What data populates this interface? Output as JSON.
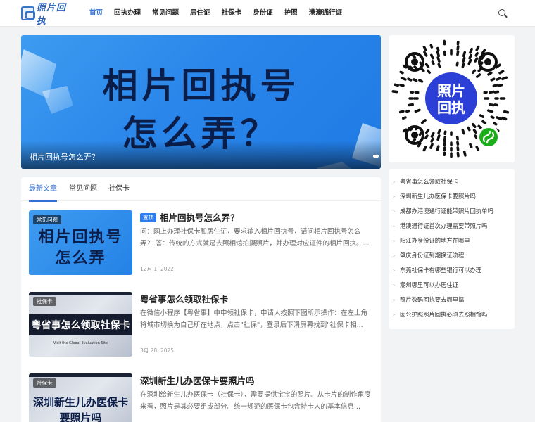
{
  "header": {
    "logo_text": "照片回执",
    "nav": [
      {
        "label": "首页",
        "active": true
      },
      {
        "label": "回执办理",
        "active": false
      },
      {
        "label": "常见问题",
        "active": false
      },
      {
        "label": "居住证",
        "active": false
      },
      {
        "label": "社保卡",
        "active": false
      },
      {
        "label": "身份证",
        "active": false
      },
      {
        "label": "护照",
        "active": false
      },
      {
        "label": "港澳通行证",
        "active": false
      }
    ],
    "search_icon": "search-icon"
  },
  "banner": {
    "line1": "相片回执号",
    "line2": "怎么弄？",
    "caption": "相片回执号怎么弄？"
  },
  "tabs": [
    "最新文章",
    "常见问题",
    "社保卡"
  ],
  "posts": [
    {
      "thumb_tag": "常见问题",
      "thumb_line1": "相片回执号",
      "thumb_line2": "怎么弄",
      "badge": "置顶",
      "title": "相片回执号怎么弄？",
      "excerpt": "问：网上办理社保卡和居住证，要求输入相片回执号，请问相片回执号怎么弄？ 答：传统的方式就是去照相馆拍摄照片，并办理对应证件的相片回执。...",
      "date": "12月 1, 2022"
    },
    {
      "thumb_tag": "社保卡",
      "thumb_line1": "粤省事怎么领取社保卡",
      "thumb_small": "Visit the Global Evaluation Site",
      "title": "粤省事怎么领取社保卡",
      "excerpt": "在微信小程序【粤省事】中申领社保卡，申请人按照下图所示操作：在左上角将城市切换为自己所在地点，点击\"社保\"，登录后下滑屏幕找到\"社保卡相...",
      "date": "3月 28, 2025"
    },
    {
      "thumb_tag": "社保卡",
      "thumb_line1": "深圳新生儿办医保卡",
      "thumb_line2": "要照片吗",
      "title": "深圳新生儿办医保卡要照片吗",
      "excerpt": "在深圳给新生儿办医保卡（社保卡），需要提供宝宝的照片。从卡片的制作角度来看，照片是其必要组成部分。统一规范的医保卡包含持卡人的基本信息...",
      "date": ""
    }
  ],
  "qr": {
    "center_text_1": "照片",
    "center_text_2": "回执",
    "icon": "wechat-mini-program-icon"
  },
  "sidebar_links": [
    "粤省事怎么领取社保卡",
    "深圳新生儿办医保卡要照片吗",
    "成都办港澳通行证能带照片回执单吗",
    "港澳通行证首次办理需要带照片吗",
    "阳江办身份证的地方在哪里",
    "肇庆身份证到期换证流程",
    "东莞社保卡有哪些银行可以办理",
    "潮州哪里可以办居住证",
    "照片数码回执要去哪里搞",
    "因公护照照片回执必须去照相馆吗"
  ],
  "colors": {
    "accent": "#2f6fd6",
    "banner_blue": "#2a86ea",
    "background": "#f2f3f5"
  }
}
